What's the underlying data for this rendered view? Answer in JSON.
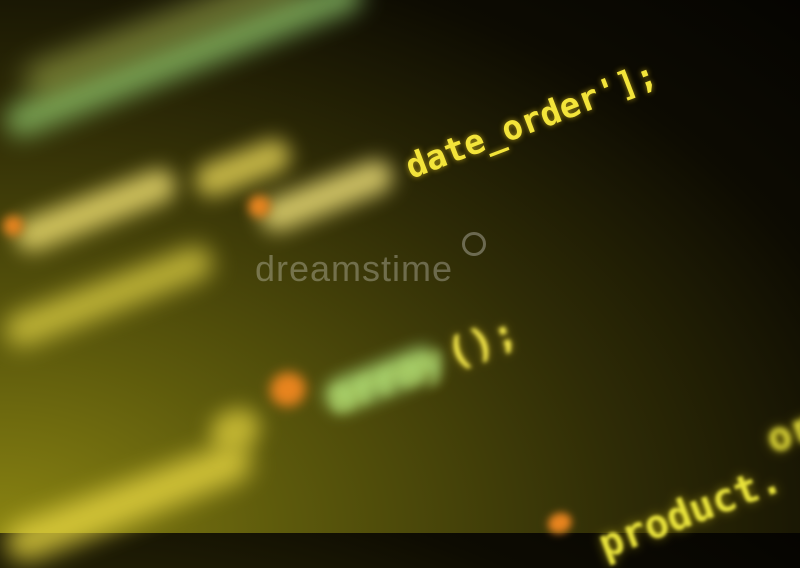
{
  "code": {
    "line_date_order": "date_order'];",
    "line_array_call": "();",
    "line_array_word": "array",
    "line_product": "product.",
    "line_product_suffix": "ord"
  },
  "watermark": {
    "text": "dreamstime"
  },
  "colors": {
    "code_yellow": "#f3e43a",
    "code_green": "#9fd36a",
    "accent_orange": "#e8841e",
    "background_dark": "#050401",
    "background_olive": "#8a8412"
  }
}
